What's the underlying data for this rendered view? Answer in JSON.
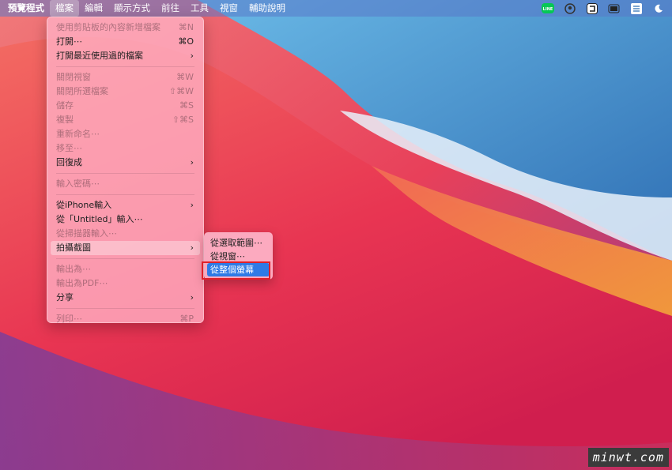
{
  "menubar": {
    "app_name": "預覽程式",
    "items": [
      "檔案",
      "編輯",
      "顯示方式",
      "前往",
      "工具",
      "視窗",
      "輔助說明"
    ],
    "active_index": 0,
    "status_icons": [
      "line-icon",
      "user-circle-icon",
      "reader-icon",
      "battery-icon",
      "input-method-icon",
      "moon-icon"
    ],
    "line_label": "LINE"
  },
  "file_menu": {
    "items": [
      {
        "label": "使用剪貼板的內容新增檔案",
        "shortcut": "⌘N",
        "enabled": false
      },
      {
        "label": "打開⋯",
        "shortcut": "⌘O",
        "enabled": true
      },
      {
        "label": "打開最近使用過的檔案",
        "shortcut": "›",
        "enabled": true
      },
      {
        "label": "關閉視窗",
        "shortcut": "⌘W",
        "enabled": false
      },
      {
        "label": "關閉所選檔案",
        "shortcut": "⇧⌘W",
        "enabled": false
      },
      {
        "label": "儲存",
        "shortcut": "⌘S",
        "enabled": false
      },
      {
        "label": "複製",
        "shortcut": "⇧⌘S",
        "enabled": false
      },
      {
        "label": "重新命名⋯",
        "shortcut": "",
        "enabled": false
      },
      {
        "label": "移至⋯",
        "shortcut": "",
        "enabled": false
      },
      {
        "label": "回復成",
        "shortcut": "›",
        "enabled": true
      },
      {
        "label": "輸入密碼⋯",
        "shortcut": "",
        "enabled": false
      },
      {
        "label": "從iPhone輸入",
        "shortcut": "›",
        "enabled": true
      },
      {
        "label": "從「Untitled」輸入⋯",
        "shortcut": "",
        "enabled": true
      },
      {
        "label": "從掃描器輸入⋯",
        "shortcut": "",
        "enabled": false
      },
      {
        "label": "拍攝截圖",
        "shortcut": "›",
        "enabled": true,
        "highlighted": true
      },
      {
        "label": "輸出為⋯",
        "shortcut": "",
        "enabled": false
      },
      {
        "label": "輸出為PDF⋯",
        "shortcut": "",
        "enabled": false
      },
      {
        "label": "分享",
        "shortcut": "›",
        "enabled": true
      },
      {
        "label": "列印⋯",
        "shortcut": "⌘P",
        "enabled": false
      }
    ]
  },
  "screenshot_submenu": {
    "items": [
      {
        "label": "從選取範圍⋯",
        "selected": false
      },
      {
        "label": "從視窗⋯",
        "selected": false
      },
      {
        "label": "從整個螢幕",
        "selected": true
      }
    ]
  },
  "watermark": "minwt.com"
}
